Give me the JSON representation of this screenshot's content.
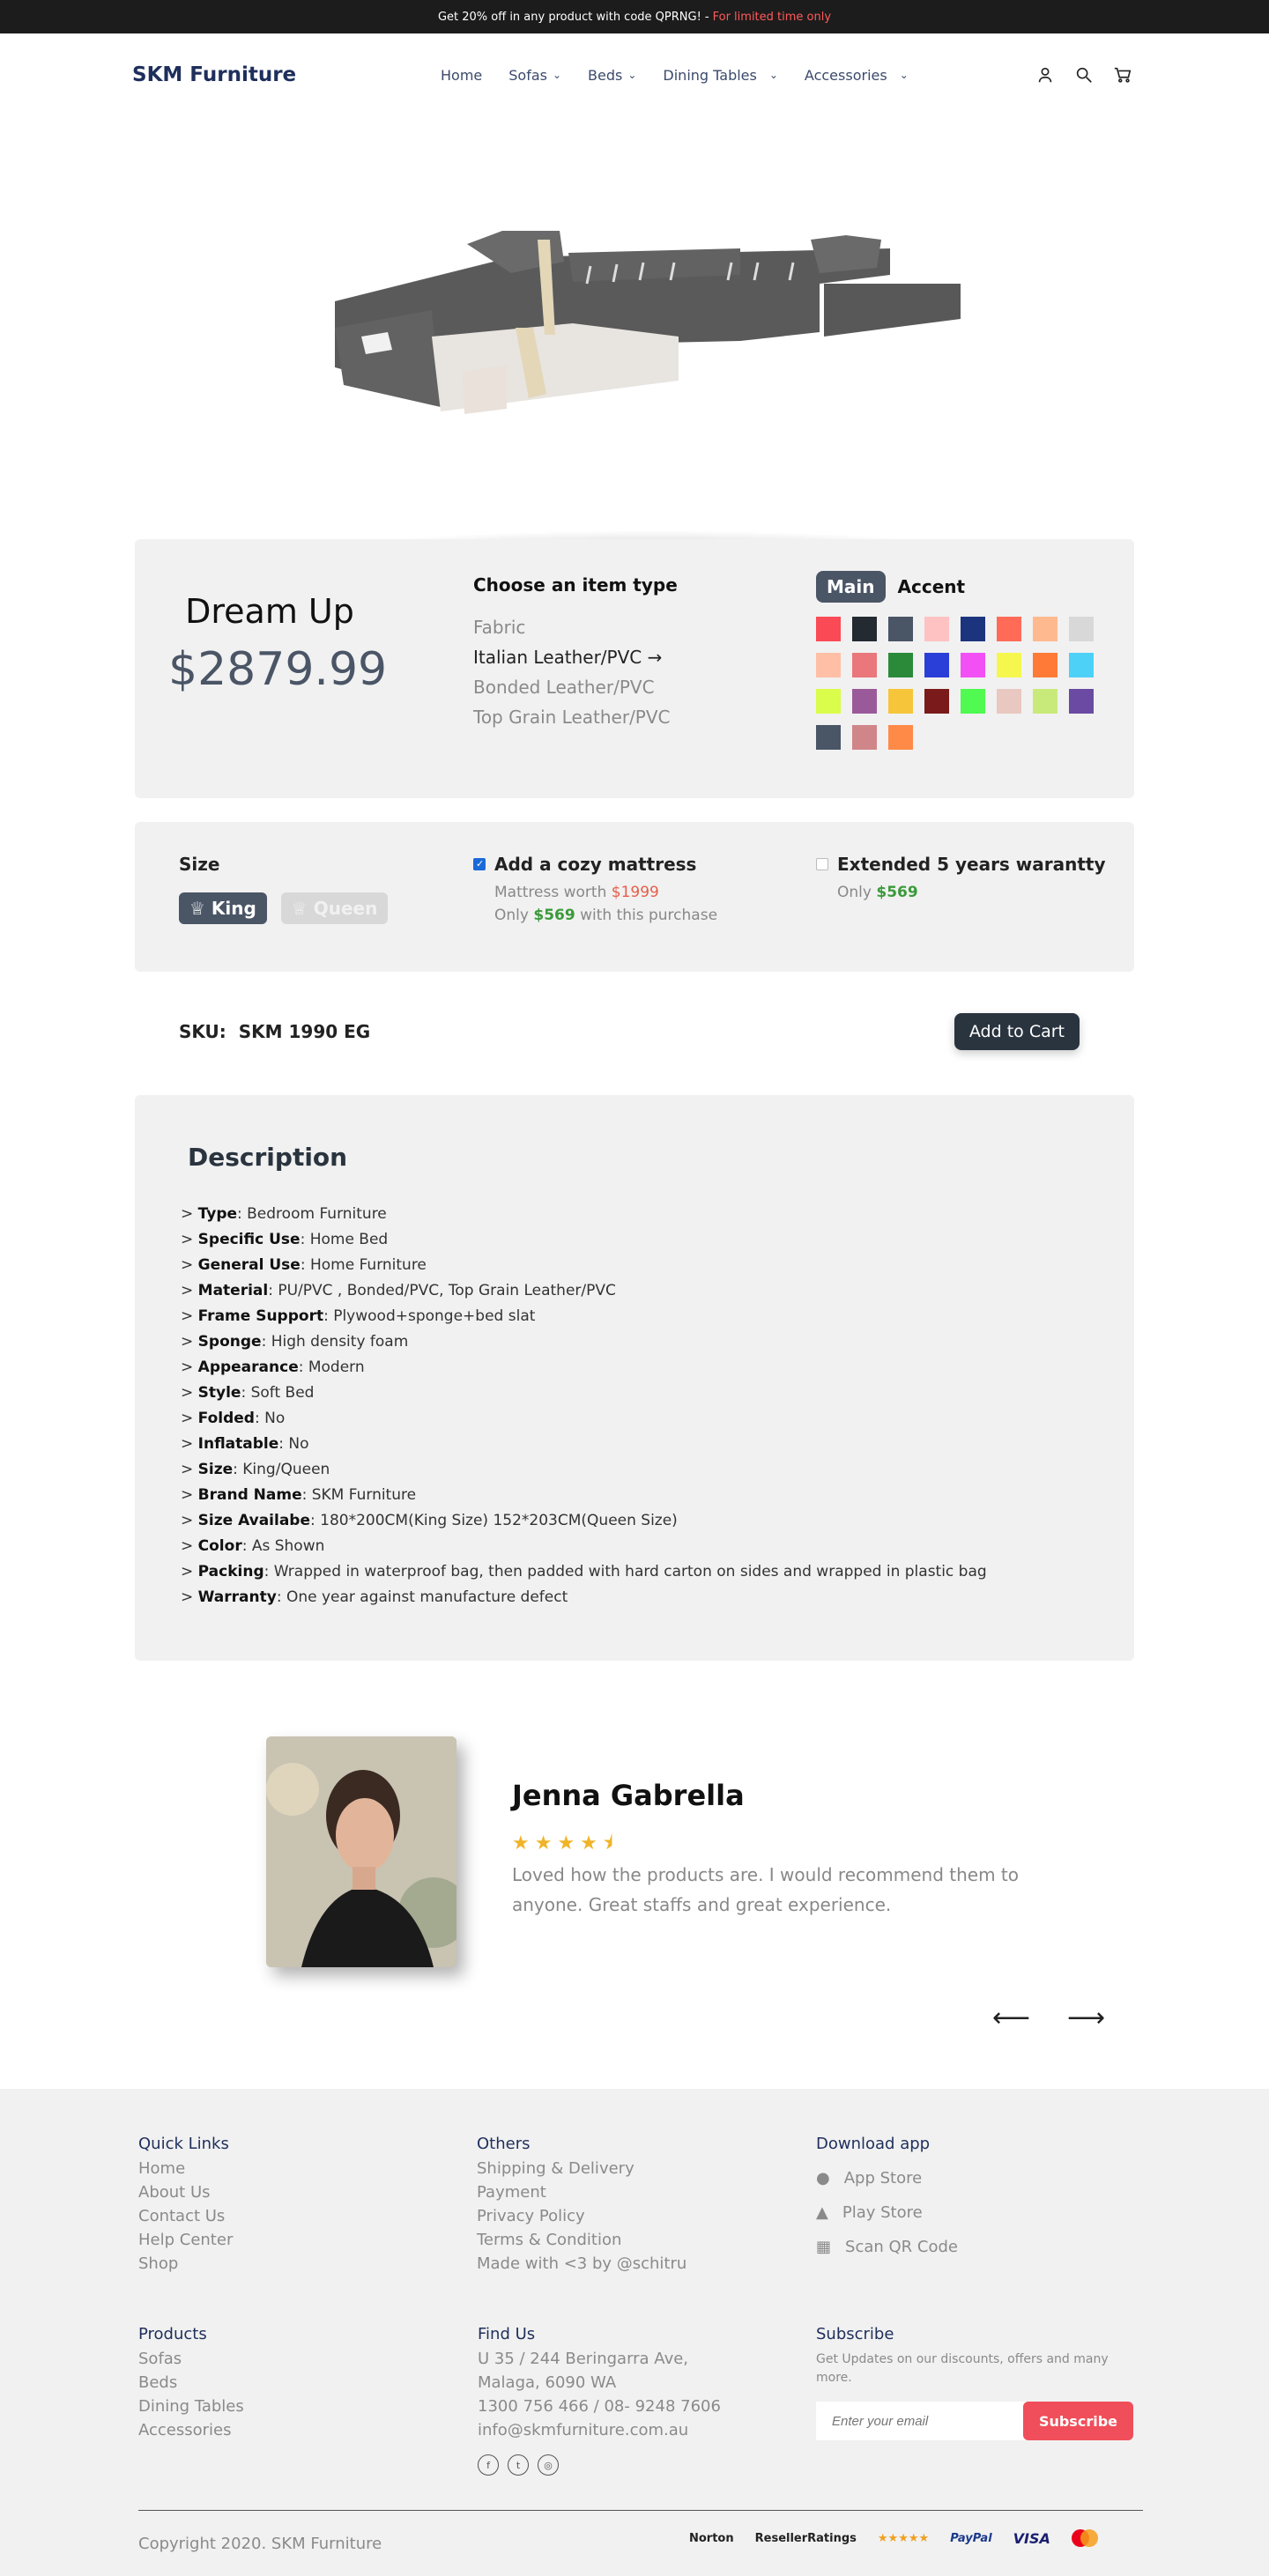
{
  "promo": {
    "text": "Get 20% off in any product with code QPRNG! -",
    "highlight": "For limited time only"
  },
  "brand": "SKM Furniture",
  "nav": {
    "items": [
      {
        "label": "Home",
        "dropdown": false
      },
      {
        "label": "Sofas",
        "dropdown": true
      },
      {
        "label": "Beds",
        "dropdown": true
      },
      {
        "label": "Dining Tables",
        "dropdown": true
      },
      {
        "label": "Accessories",
        "dropdown": true
      }
    ]
  },
  "product": {
    "name": "Dream Up",
    "price": "$2879.99",
    "type_heading": "Choose an item type",
    "types": [
      "Fabric",
      "Italian Leather/PVC",
      "Bonded Leather/PVC",
      "Top Grain Leather/PVC"
    ],
    "selected_type_arrow": "→",
    "color_tabs": {
      "main": "Main",
      "accent": "Accent"
    },
    "swatches": [
      "#fa4a56",
      "#232a32",
      "#4a5566",
      "#ffc2c2",
      "#1c347e",
      "#ff6b57",
      "#ffb98f",
      "#d8d8d8",
      "#ffbfa6",
      "#e9777b",
      "#2a8a3a",
      "#2a3fd8",
      "#f24ff5",
      "#f6f74e",
      "#ff7a37",
      "#4dd1f7",
      "#dafc4a",
      "#9a5a9a",
      "#f6c53a",
      "#7a1a1a",
      "#50fa50",
      "#e8c8c0",
      "#c8ea7a",
      "#6a4aa2",
      "#4a5566",
      "#d08688",
      "#ff8a48"
    ]
  },
  "options": {
    "size_label": "Size",
    "sizes": [
      {
        "label": "King",
        "icon": "♕"
      },
      {
        "label": "Queen",
        "icon": "♕"
      }
    ],
    "mattress": {
      "title": "Add a cozy mattress",
      "worth_prefix": "Mattress worth",
      "worth": "$1999",
      "only": "Only",
      "price": "$569",
      "suffix": "with this purchase"
    },
    "warranty": {
      "title": "Extended 5 years warantty",
      "only": "Only",
      "price": "$569"
    }
  },
  "sku": {
    "label": "SKU:",
    "value": "SKM 1990 EG"
  },
  "cart_label": "Add to Cart",
  "description": {
    "title": "Description",
    "items": [
      {
        "k": "Type",
        "v": ": Bedroom Furniture"
      },
      {
        "k": "Specific Use",
        "v": ": Home Bed"
      },
      {
        "k": "General Use",
        "v": ": Home Furniture"
      },
      {
        "k": "Material",
        "v": ": PU/PVC , Bonded/PVC, Top Grain Leather/PVC"
      },
      {
        "k": "Frame Support",
        "v": ": Plywood+sponge+bed slat"
      },
      {
        "k": "Sponge",
        "v": ": High density foam"
      },
      {
        "k": "Appearance",
        "v": ": Modern"
      },
      {
        "k": "Style",
        "v": ": Soft Bed"
      },
      {
        "k": "Folded",
        "v": ": No"
      },
      {
        "k": "Inflatable",
        "v": ": No"
      },
      {
        "k": "Size",
        "v": ": King/Queen"
      },
      {
        "k": "Brand Name",
        "v": ": SKM Furniture"
      },
      {
        "k": "Size Availabe",
        "v": ": 180*200CM(King Size) 152*203CM(Queen Size)"
      },
      {
        "k": "Color",
        "v": ": As Shown"
      },
      {
        "k": "Packing",
        "v": ": Wrapped in waterproof bag, then padded with hard carton on sides and wrapped in plastic bag"
      },
      {
        "k": "Warranty",
        "v": ": One year against manufacture defect"
      }
    ]
  },
  "review": {
    "name": "Jenna Gabrella",
    "rating": 4.5,
    "stars": "★★★★⯨",
    "text": "Loved how the products are. I would recommend them to anyone. Great staffs and great experience.",
    "prev": "⟵",
    "next": "⟶"
  },
  "footer": {
    "quick_links": {
      "title": "Quick Links",
      "items": [
        "Home",
        "About Us",
        "Contact Us",
        "Help Center",
        "Shop"
      ]
    },
    "others": {
      "title": "Others",
      "items": [
        "Shipping & Delivery",
        "Payment",
        "Privacy Policy",
        "Terms & Condition",
        "Made with <3 by @schitru"
      ]
    },
    "download": {
      "title": "Download app",
      "items": [
        "App Store",
        "Play Store",
        "Scan QR Code"
      ]
    },
    "products": {
      "title": "Products",
      "items": [
        "Sofas",
        "Beds",
        "Dining Tables",
        "Accessories"
      ]
    },
    "find_us": {
      "title": "Find Us",
      "items": [
        "U 35 / 244 Beringarra Ave,",
        "Malaga, 6090 WA",
        "1300 756 466 / 08- 9248 7606",
        "info@skmfurniture.com.au"
      ]
    },
    "subscribe": {
      "title": "Subscribe",
      "text": "Get Updates on our discounts, offers and many more.",
      "placeholder": "Enter your email",
      "button": "Subscribe"
    },
    "copyright": "Copyright 2020. SKM Furniture",
    "badges": [
      "Norton",
      "ResellerRatings",
      "★★★★★",
      "PayPal",
      "VISA"
    ]
  }
}
